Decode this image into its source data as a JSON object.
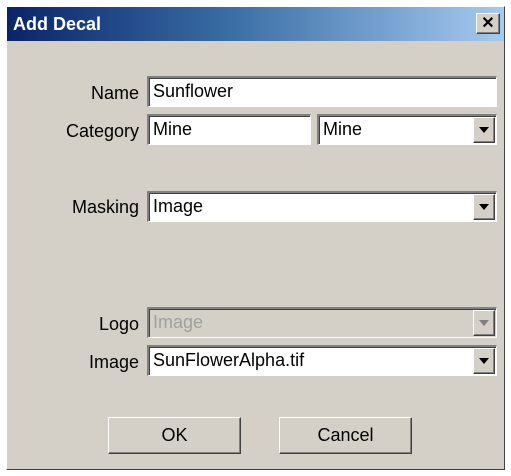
{
  "window": {
    "title": "Add Decal",
    "close_label": "✕"
  },
  "form": {
    "name_label": "Name",
    "name_value": "Sunflower",
    "category_label": "Category",
    "category_value": "Mine",
    "category_select_value": "Mine",
    "masking_label": "Masking",
    "masking_value": "Image",
    "logo_label": "Logo",
    "logo_value": "Image",
    "image_label": "Image",
    "image_value": "SunFlowerAlpha.tif"
  },
  "buttons": {
    "ok": "OK",
    "cancel": "Cancel"
  },
  "icons": {
    "close": "close-icon",
    "dropdown": "chevron-down-icon"
  }
}
